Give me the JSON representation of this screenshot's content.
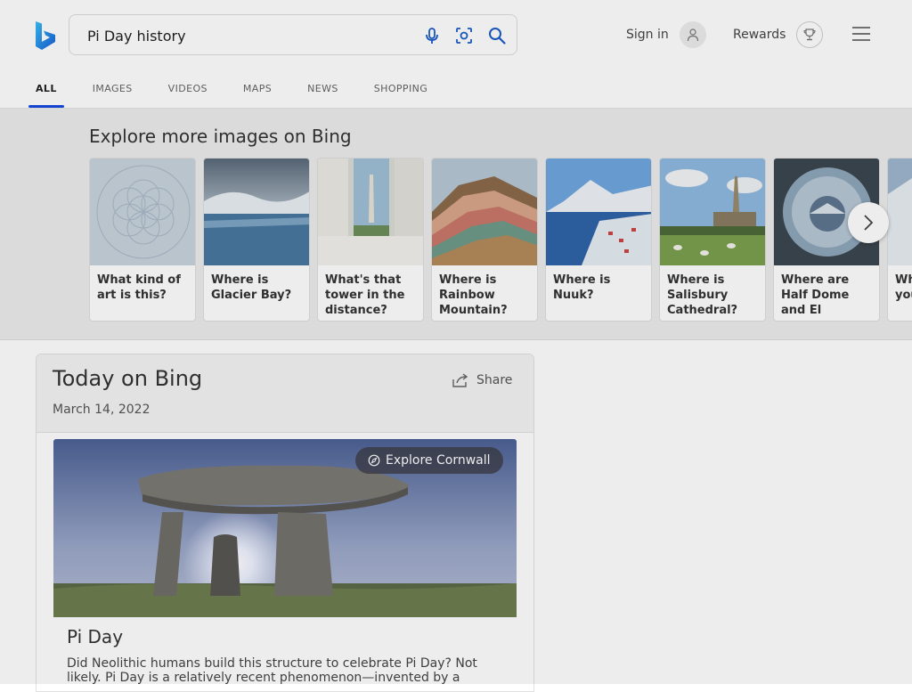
{
  "search": {
    "query": "Pi Day history"
  },
  "header": {
    "signin_label": "Sign in",
    "rewards_label": "Rewards"
  },
  "tabs": [
    {
      "label": "ALL"
    },
    {
      "label": "IMAGES"
    },
    {
      "label": "VIDEOS"
    },
    {
      "label": "MAPS"
    },
    {
      "label": "NEWS"
    },
    {
      "label": "SHOPPING"
    }
  ],
  "explore": {
    "title": "Explore more images on Bing",
    "cards": [
      {
        "caption": "What kind of art is this?"
      },
      {
        "caption": "Where is Glacier Bay?"
      },
      {
        "caption": "What's that tower in the distance?"
      },
      {
        "caption": "Where is Rainbow Mountain?"
      },
      {
        "caption": "Where is Nuuk?"
      },
      {
        "caption": "Where is Salisbury Cathedral?"
      },
      {
        "caption": "Where are Half Dome and El Capitan?"
      },
      {
        "caption": "Where are you the"
      }
    ]
  },
  "today": {
    "title": "Today on Bing",
    "date": "March 14, 2022",
    "share_label": "Share",
    "explore_label": "Explore Cornwall",
    "story_title": "Pi Day",
    "story_text": "Did Neolithic humans build this structure to celebrate Pi Day? Not likely. Pi Day is a relatively recent phenomenon—invented by a"
  },
  "colors": {
    "accent": "#174ae4",
    "logo": "#1b8fd6"
  }
}
